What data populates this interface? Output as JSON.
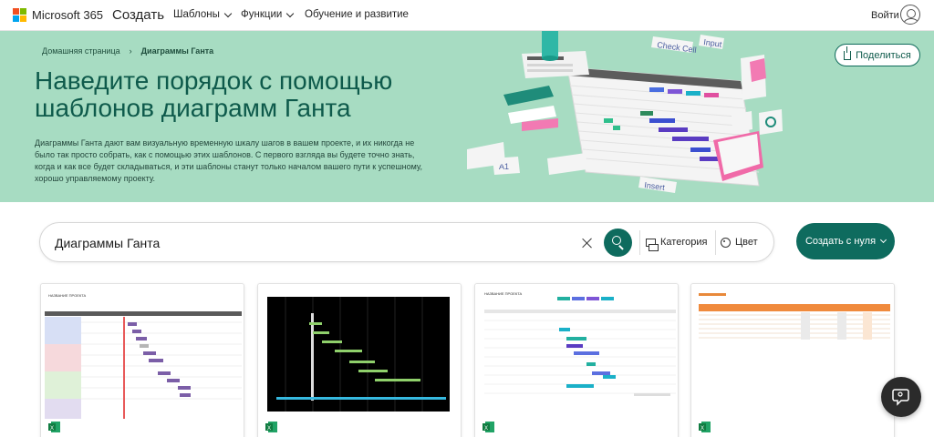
{
  "nav": {
    "brand": "Microsoft 365",
    "create": "Создать",
    "items": [
      {
        "label": "Шаблоны"
      },
      {
        "label": "Функции"
      },
      {
        "label": "Обучение и развитие"
      }
    ],
    "signin": "Войти"
  },
  "hero": {
    "breadcrumb_home": "Домашняя страница",
    "breadcrumb_current": "Диаграммы Ганта",
    "title": "Наведите порядок с помощью шаблонов диаграмм Ганта",
    "description": "Диаграммы Ганта дают вам визуальную временную шкалу шагов в вашем проекте, и их никогда не было так просто собрать, как с помощью этих шаблонов. С первого взгляда вы будете точно знать, когда и как все будет складываться, и эти шаблоны станут только началом вашего пути к успешному, хорошо управляемому проекту.",
    "share": "Поделиться",
    "art_labels": [
      "Check Cell",
      "Input",
      "A1",
      "Insert"
    ],
    "bg_color": "#a7dcc2",
    "title_color": "#0e5a4b"
  },
  "search": {
    "value": "Диаграммы Ганта",
    "category": "Категория",
    "color": "Цвет"
  },
  "create_button": "Создать с нуля",
  "cards": [
    {
      "title": "НАЗВАНИЕ ПРОЕКТА",
      "app": "excel-icon"
    },
    {
      "title": "",
      "app": "excel-icon"
    },
    {
      "title": "НАЗВАНИЕ ПРОЕКТА",
      "app": "excel-icon"
    },
    {
      "title": "",
      "app": "excel-icon"
    }
  ],
  "accent": "#0e6b5e"
}
